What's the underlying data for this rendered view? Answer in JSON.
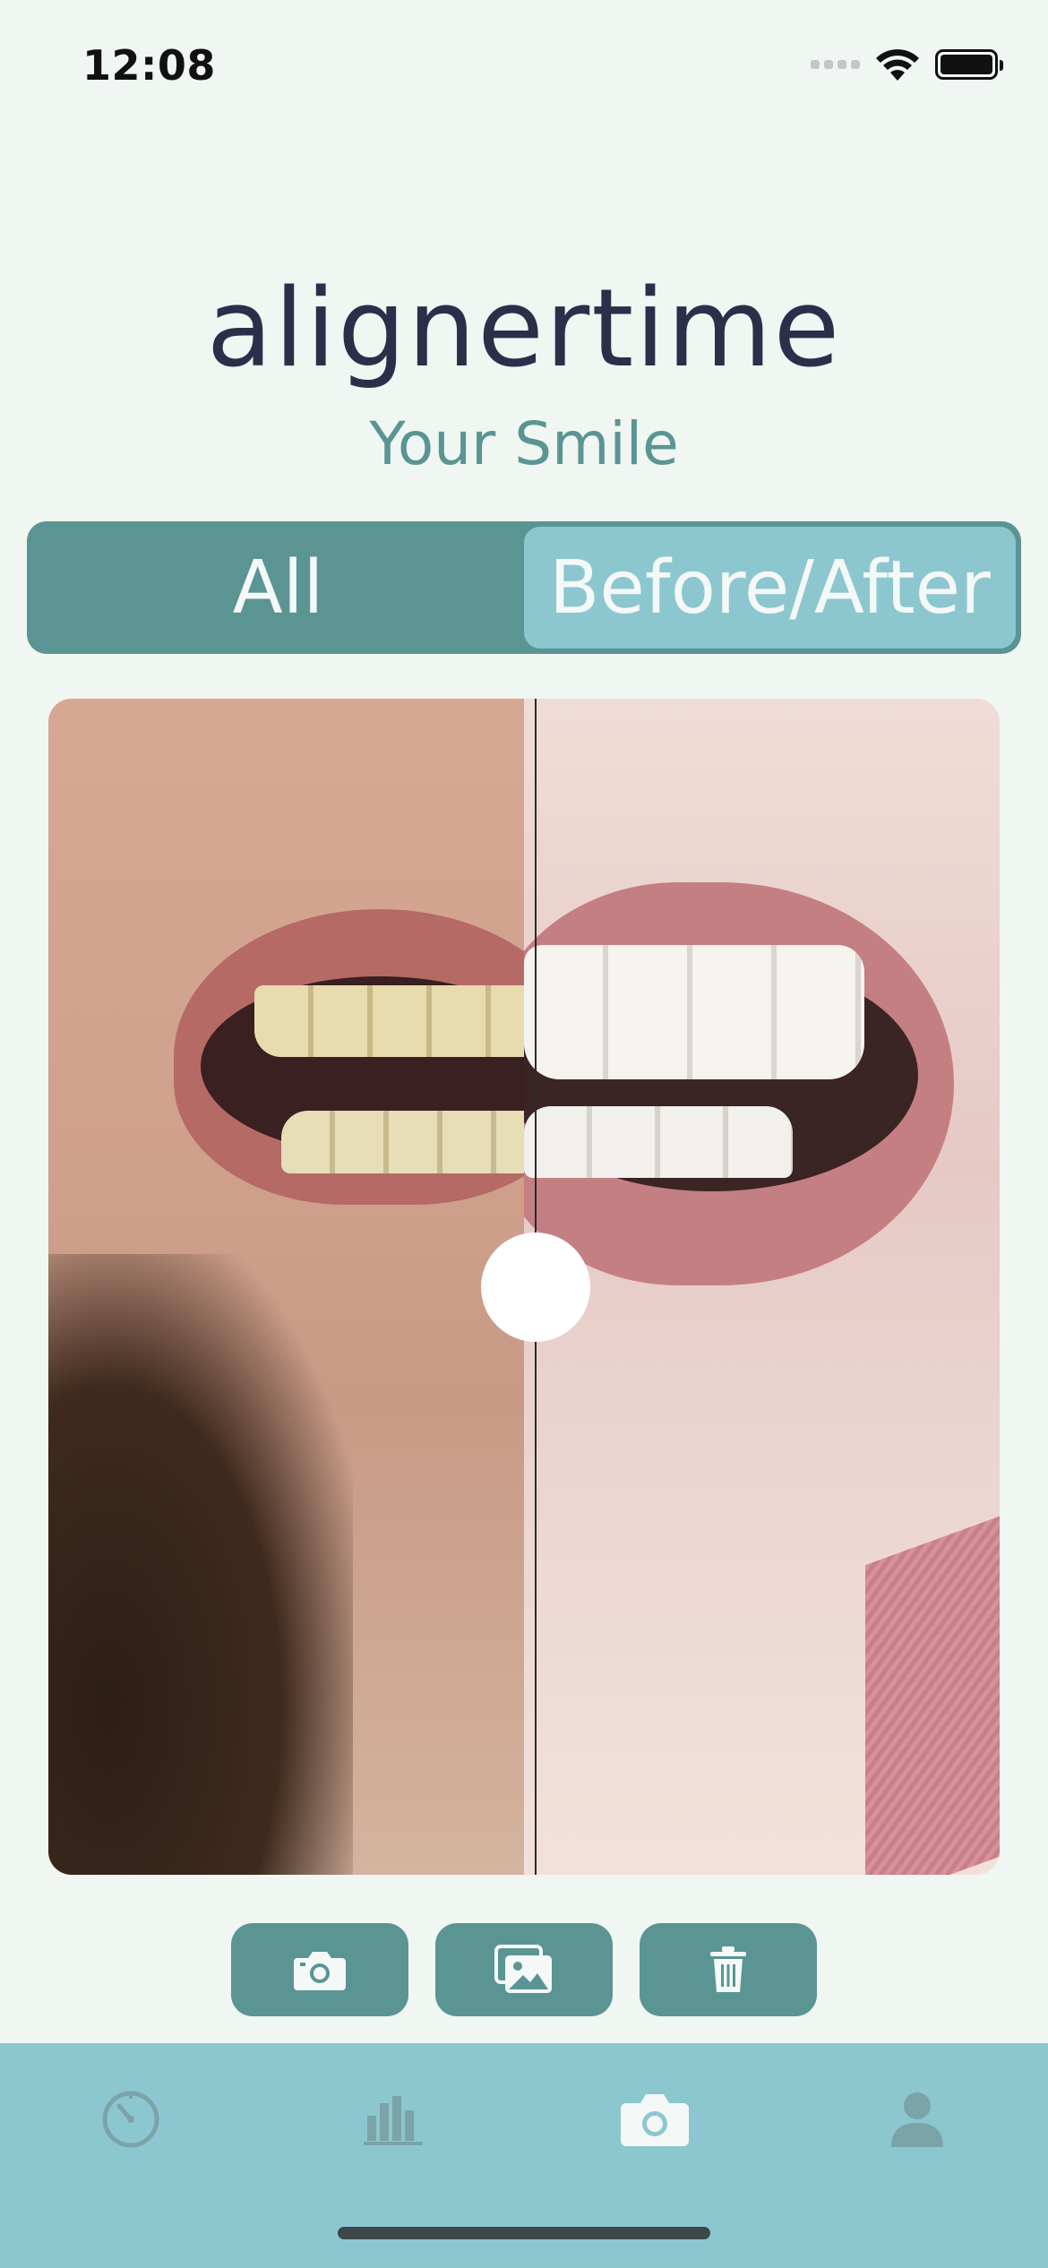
{
  "status_bar": {
    "time": "12:08"
  },
  "header": {
    "logo": "alignertime",
    "subtitle": "Your Smile"
  },
  "segments": [
    {
      "label": "All",
      "active": false
    },
    {
      "label": "Before/After",
      "active": true
    }
  ],
  "compare": {
    "left_image": "before-photo",
    "right_image": "after-photo",
    "slider_position": 0.51
  },
  "actions": [
    {
      "icon": "camera-icon"
    },
    {
      "icon": "gallery-icon"
    },
    {
      "icon": "trash-icon"
    }
  ],
  "tabbar": [
    {
      "icon": "timer-icon",
      "active": false
    },
    {
      "icon": "chart-icon",
      "active": false
    },
    {
      "icon": "camera-icon",
      "active": true
    },
    {
      "icon": "profile-icon",
      "active": false
    }
  ],
  "colors": {
    "background": "#f0f6f1",
    "primary": "#5a9594",
    "accent": "#8cc7d0",
    "text_dark": "#2c2f4a",
    "inactive_icon": "#7aa4a8"
  }
}
